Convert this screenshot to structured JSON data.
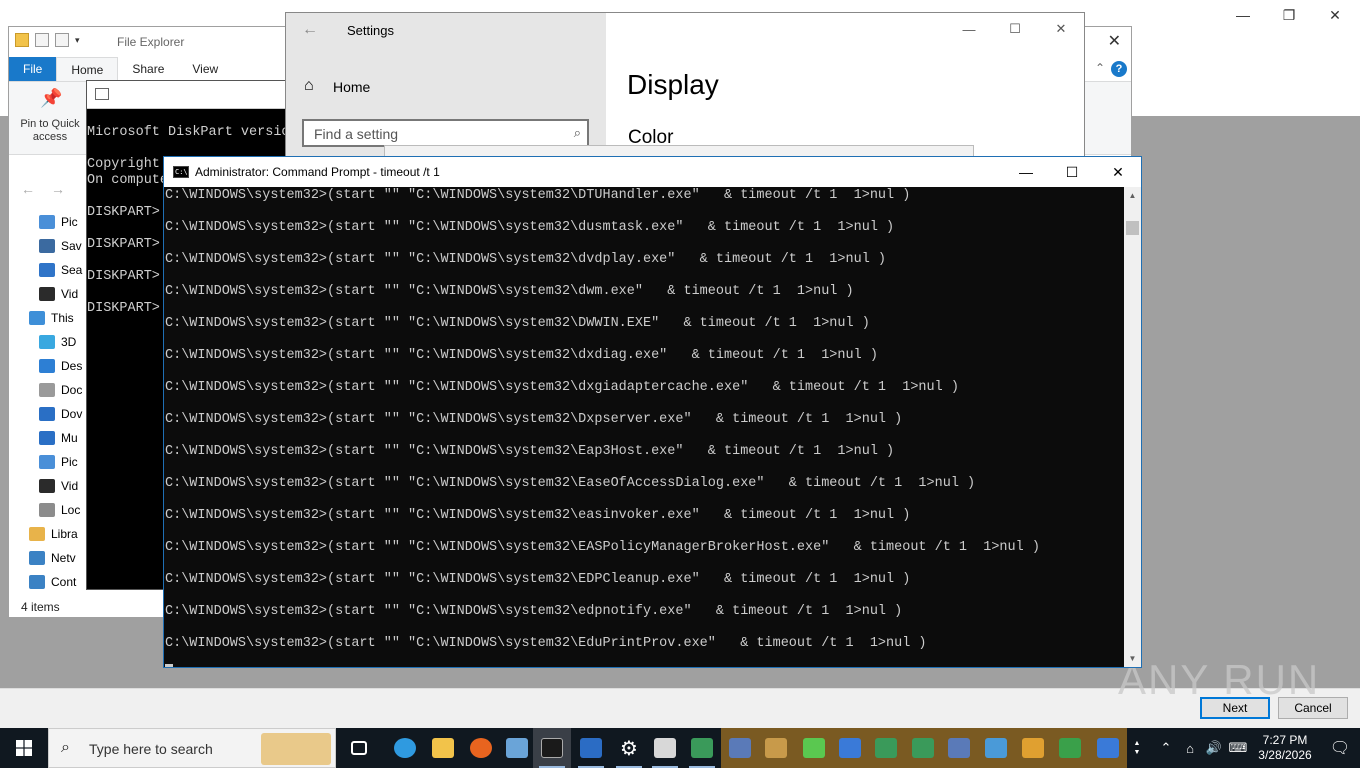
{
  "background_window": {
    "controls": [
      "—",
      "❐",
      "✕"
    ]
  },
  "file_explorer": {
    "title": "File Explorer",
    "tabs": [
      "File",
      "Home",
      "Share",
      "View"
    ],
    "pin_label": "Pin to Quick access",
    "nav_items": [
      {
        "label": "Pic",
        "icon": "pictures-icon",
        "color": "#4a8fd8"
      },
      {
        "label": "Sav",
        "icon": "saved-games-icon",
        "color": "#3b6aa0"
      },
      {
        "label": "Sea",
        "icon": "searches-icon",
        "color": "#2f74c8"
      },
      {
        "label": "Vid",
        "icon": "videos-icon",
        "color": "#2b2b2b"
      },
      {
        "label": "This",
        "icon": "this-pc-icon",
        "color": "#3e8fd8"
      },
      {
        "label": "3D",
        "icon": "3d-objects-icon",
        "color": "#39a8e0"
      },
      {
        "label": "Des",
        "icon": "desktop-icon",
        "color": "#2d7fd4"
      },
      {
        "label": "Doc",
        "icon": "documents-icon",
        "color": "#9a9a9a"
      },
      {
        "label": "Dov",
        "icon": "downloads-icon",
        "color": "#2a6fc5"
      },
      {
        "label": "Mu",
        "icon": "music-icon",
        "color": "#2a6fc5"
      },
      {
        "label": "Pic",
        "icon": "pictures-icon",
        "color": "#4a8fd8"
      },
      {
        "label": "Vid",
        "icon": "videos-icon",
        "color": "#2b2b2b"
      },
      {
        "label": "Loc",
        "icon": "local-disk-icon",
        "color": "#8c8c8c"
      },
      {
        "label": "Libra",
        "icon": "libraries-icon",
        "color": "#e8b34a"
      },
      {
        "label": "Netv",
        "icon": "network-icon",
        "color": "#3b82c4"
      },
      {
        "label": "Cont",
        "icon": "control-panel-icon",
        "color": "#3b82c4"
      }
    ],
    "status": "4 items"
  },
  "diskpart": {
    "lines": [
      "Microsoft DiskPart versio",
      "",
      "Copyright",
      "On compute",
      "",
      "DISKPART>",
      "",
      "DISKPART>",
      "",
      "DISKPART>",
      "",
      "DISKPART>"
    ]
  },
  "settings": {
    "title": "Settings",
    "home": "Home",
    "search_placeholder": "Find a setting",
    "page_title": "Display",
    "section": "Color"
  },
  "cmd": {
    "title": "Administrator: Command Prompt - timeout  /t 1",
    "lines": [
      "C:\\WINDOWS\\system32>(start \"\" \"C:\\WINDOWS\\system32\\DTUHandler.exe\"   & timeout /t 1  1>nul )",
      "C:\\WINDOWS\\system32>(start \"\" \"C:\\WINDOWS\\system32\\dusmtask.exe\"   & timeout /t 1  1>nul )",
      "C:\\WINDOWS\\system32>(start \"\" \"C:\\WINDOWS\\system32\\dvdplay.exe\"   & timeout /t 1  1>nul )",
      "C:\\WINDOWS\\system32>(start \"\" \"C:\\WINDOWS\\system32\\dwm.exe\"   & timeout /t 1  1>nul )",
      "C:\\WINDOWS\\system32>(start \"\" \"C:\\WINDOWS\\system32\\DWWIN.EXE\"   & timeout /t 1  1>nul )",
      "C:\\WINDOWS\\system32>(start \"\" \"C:\\WINDOWS\\system32\\dxdiag.exe\"   & timeout /t 1  1>nul )",
      "C:\\WINDOWS\\system32>(start \"\" \"C:\\WINDOWS\\system32\\dxgiadaptercache.exe\"   & timeout /t 1  1>nul )",
      "C:\\WINDOWS\\system32>(start \"\" \"C:\\WINDOWS\\system32\\Dxpserver.exe\"   & timeout /t 1  1>nul )",
      "C:\\WINDOWS\\system32>(start \"\" \"C:\\WINDOWS\\system32\\Eap3Host.exe\"   & timeout /t 1  1>nul )",
      "C:\\WINDOWS\\system32>(start \"\" \"C:\\WINDOWS\\system32\\EaseOfAccessDialog.exe\"   & timeout /t 1  1>nul )",
      "C:\\WINDOWS\\system32>(start \"\" \"C:\\WINDOWS\\system32\\easinvoker.exe\"   & timeout /t 1  1>nul )",
      "C:\\WINDOWS\\system32>(start \"\" \"C:\\WINDOWS\\system32\\EASPolicyManagerBrokerHost.exe\"   & timeout /t 1  1>nul )",
      "C:\\WINDOWS\\system32>(start \"\" \"C:\\WINDOWS\\system32\\EDPCleanup.exe\"   & timeout /t 1  1>nul )",
      "C:\\WINDOWS\\system32>(start \"\" \"C:\\WINDOWS\\system32\\edpnotify.exe\"   & timeout /t 1  1>nul )",
      "C:\\WINDOWS\\system32>(start \"\" \"C:\\WINDOWS\\system32\\EduPrintProv.exe\"   & timeout /t 1  1>nul )"
    ]
  },
  "setup_dialog": {
    "next": "Next",
    "cancel": "Cancel"
  },
  "watermark": "ANY RUN",
  "taskbar": {
    "search_placeholder": "Type here to search",
    "apps": [
      {
        "name": "task-view",
        "color": "#ffffff"
      },
      {
        "name": "edge",
        "color": "#2f9ae0"
      },
      {
        "name": "file-explorer",
        "color": "#f2c34a"
      },
      {
        "name": "firefox",
        "color": "#e8641f"
      },
      {
        "name": "rdp",
        "color": "#6aa4d8"
      },
      {
        "name": "cmd",
        "color": "#1a1a1a"
      },
      {
        "name": "wordpad",
        "color": "#2b6cc4"
      },
      {
        "name": "settings",
        "color": "#ffffff"
      },
      {
        "name": "charmap",
        "color": "#d8d8d8"
      },
      {
        "name": "app-window",
        "color": "#3a9a5a"
      },
      {
        "name": "app-network",
        "color": "#5a7ab8"
      },
      {
        "name": "app-archive",
        "color": "#c89a4a"
      },
      {
        "name": "app-colors",
        "color": "#5ac850"
      },
      {
        "name": "app-monitor",
        "color": "#3a7ad8"
      },
      {
        "name": "app-doc",
        "color": "#3a9a5a"
      },
      {
        "name": "app-doc2",
        "color": "#3a9a5a"
      },
      {
        "name": "app-printer",
        "color": "#5a7ab8"
      },
      {
        "name": "app-control",
        "color": "#4a9ad8"
      },
      {
        "name": "app-key",
        "color": "#e0a030"
      },
      {
        "name": "app-font",
        "color": "#3aa04a"
      },
      {
        "name": "app-pic",
        "color": "#3a7ad8"
      }
    ],
    "time": "7:27 PM",
    "date": "3/28/2026"
  }
}
